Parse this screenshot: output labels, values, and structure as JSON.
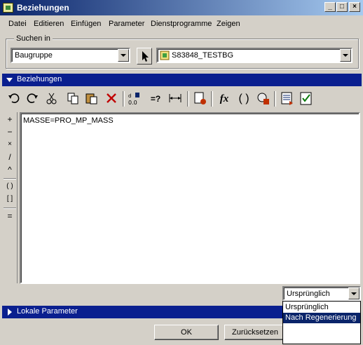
{
  "window": {
    "title": "Beziehungen",
    "controls": [
      "_",
      "□",
      "×"
    ]
  },
  "menu": [
    "Datei",
    "Editieren",
    "Einfügen",
    "Parameter",
    "Dienstprogramme",
    "Zeigen"
  ],
  "search": {
    "label": "Suchen in",
    "type_value": "Baugruppe",
    "model_value": "S83848_TESTBG"
  },
  "relations_section": {
    "label": "Beziehungen"
  },
  "toolbar_icons": [
    "undo-icon",
    "redo-icon",
    "cut-icon",
    "copy-icon",
    "paste-icon",
    "delete-icon",
    "display-values-icon",
    "evaluate-icon",
    "dimension-icon",
    "sort-icon",
    "function-icon",
    "parentheses-icon",
    "verify-icon",
    "list-icon",
    "check-icon"
  ],
  "operators": [
    "+",
    "−",
    "×",
    "/",
    "^",
    "( )",
    "[ ]",
    "="
  ],
  "editor": {
    "text": "MASSE=PRO_MP_MASS"
  },
  "order_select": {
    "value": "Ursprünglich",
    "options": [
      "Ursprünglich",
      "Nach Regenerierung"
    ],
    "highlighted": "Nach Regenerierung"
  },
  "local_params_section": {
    "label": "Lokale Parameter"
  },
  "buttons": {
    "ok": "OK",
    "reset": "Zurücksetzen"
  }
}
